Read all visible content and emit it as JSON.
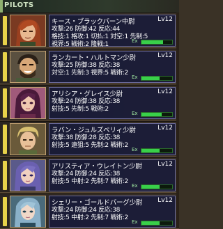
{
  "header": {
    "title": "PILOTS"
  },
  "colors": {
    "sidebar_yellow": "#e8d24a",
    "sidebar_green": "#4fb04a",
    "sidebar_red": "#c84a3a",
    "ex_green": "#39d04a"
  },
  "pilots": [
    {
      "name": "キース・ブラックバーン中尉",
      "level": "Lv12",
      "stat1": "攻撃:26 防御:42 反応:44",
      "stat2": "格技:1 格攻:1 切払:1 対空:1 先制:5",
      "stat3": "視界:5 戦術:2 隆戦:1",
      "ex_fill": 0.7,
      "sidebar_color": "#e8d24a"
    },
    {
      "name": "ランカート・ハルトマン少尉",
      "level": "Lv12",
      "stat1": "攻撃:25 防御:38 反応:38",
      "stat2": "対空:1 先制:3 視界:5 戦術:2",
      "stat3": "",
      "ex_fill": 0.6,
      "sidebar_color": "#e8d24a"
    },
    {
      "name": "アリシア・グレイス少尉",
      "level": "Lv12",
      "stat1": "攻撃:24 防御:38 反応:38",
      "stat2": "射技:5 先制:5 戦術:2",
      "stat3": "",
      "ex_fill": 0.65,
      "sidebar_color": "#e8d24a"
    },
    {
      "name": "ラバン・ジュルズベリィ少尉",
      "level": "Lv12",
      "stat1": "攻撃:38 防御:28 反応:38",
      "stat2": "射技:5 遠狙:5 先制:2 戦術:2",
      "stat3": "",
      "ex_fill": 0.6,
      "sidebar_color": "#e8d24a"
    },
    {
      "name": "アリスティア・ウレイトン少尉",
      "level": "Lv12",
      "stat1": "攻撃:24 防御:24 反応:38",
      "stat2": "射技:5 中射:2 先制:7 戦術:2",
      "stat3": "",
      "ex_fill": 0.6,
      "sidebar_color": "#e8d24a"
    },
    {
      "name": "シェリー・ゴールドバーグ少尉",
      "level": "Lv12",
      "stat1": "攻撃:24 防御:24 反応:38",
      "stat2": "射技:5 中射:2 先制:7 戦術:2",
      "stat3": "",
      "ex_fill": 0.6,
      "sidebar_color": "#e8d24a"
    }
  ]
}
